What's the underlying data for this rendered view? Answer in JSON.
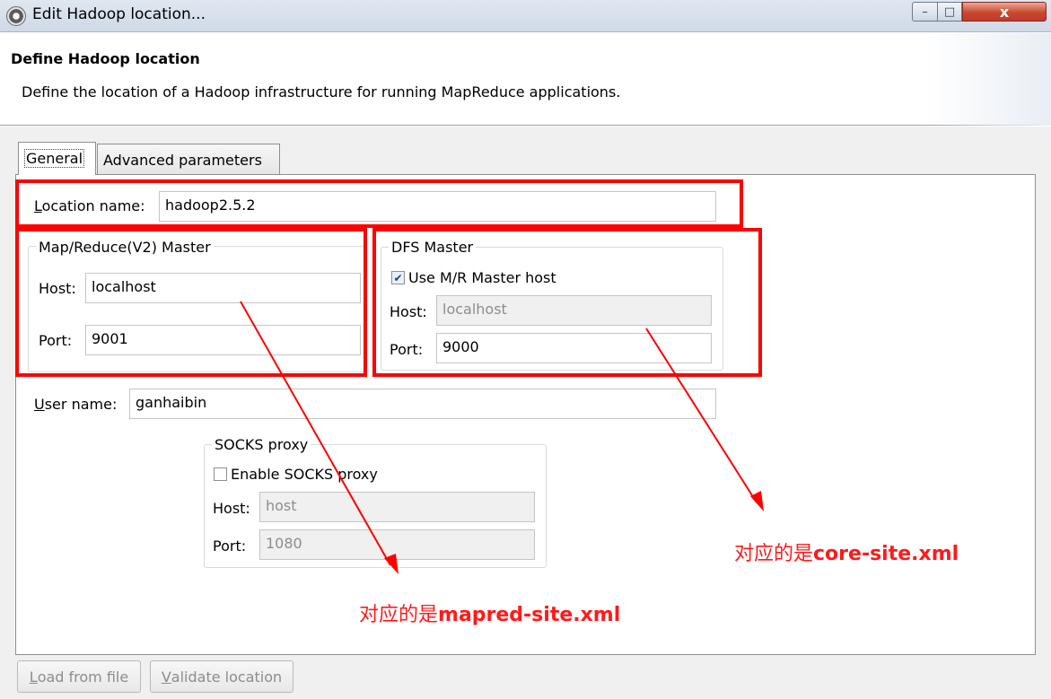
{
  "window": {
    "title": "Edit Hadoop location...",
    "close_glyph": "x",
    "min_glyph": "–",
    "max_glyph": "□"
  },
  "header": {
    "title": "Define Hadoop location",
    "description": "Define the location of a Hadoop infrastructure for running MapReduce applications."
  },
  "tabs": [
    {
      "label": "General",
      "selected": true
    },
    {
      "label": "Advanced parameters",
      "selected": false
    }
  ],
  "location": {
    "label_underlined": "L",
    "label_rest": "ocation name:",
    "value": "hadoop2.5.2"
  },
  "mr_master": {
    "title": "Map/Reduce(V2) Master",
    "host_label": "Host:",
    "host_value": "localhost",
    "port_label": "Port:",
    "port_value": "9001"
  },
  "dfs_master": {
    "title": "DFS Master",
    "use_mr_host_label": "Use M/R Master host",
    "use_mr_host_checked": true,
    "host_label": "Host:",
    "host_value": "localhost",
    "port_label": "Port:",
    "port_value": "9000"
  },
  "user": {
    "label_underlined": "U",
    "label_rest": "ser name:",
    "value": "ganhaibin"
  },
  "socks": {
    "title": "SOCKS proxy",
    "enable_label": "Enable SOCKS proxy",
    "enable_checked": false,
    "host_label": "Host:",
    "host_value": "host",
    "port_label": "Port:",
    "port_value": "1080"
  },
  "annotations": {
    "mapred_prefix": "对应的是",
    "mapred_file": "mapred-site.xml",
    "core_prefix": "对应的是",
    "core_file": "core-site.xml",
    "color": "#ff0000"
  },
  "buttons": {
    "load_underlined": "L",
    "load_rest": "oad from file",
    "validate_underlined": "V",
    "validate_rest": "alidate location"
  },
  "colors": {
    "highlight": "#ff0000",
    "check": "#1f3a93"
  }
}
